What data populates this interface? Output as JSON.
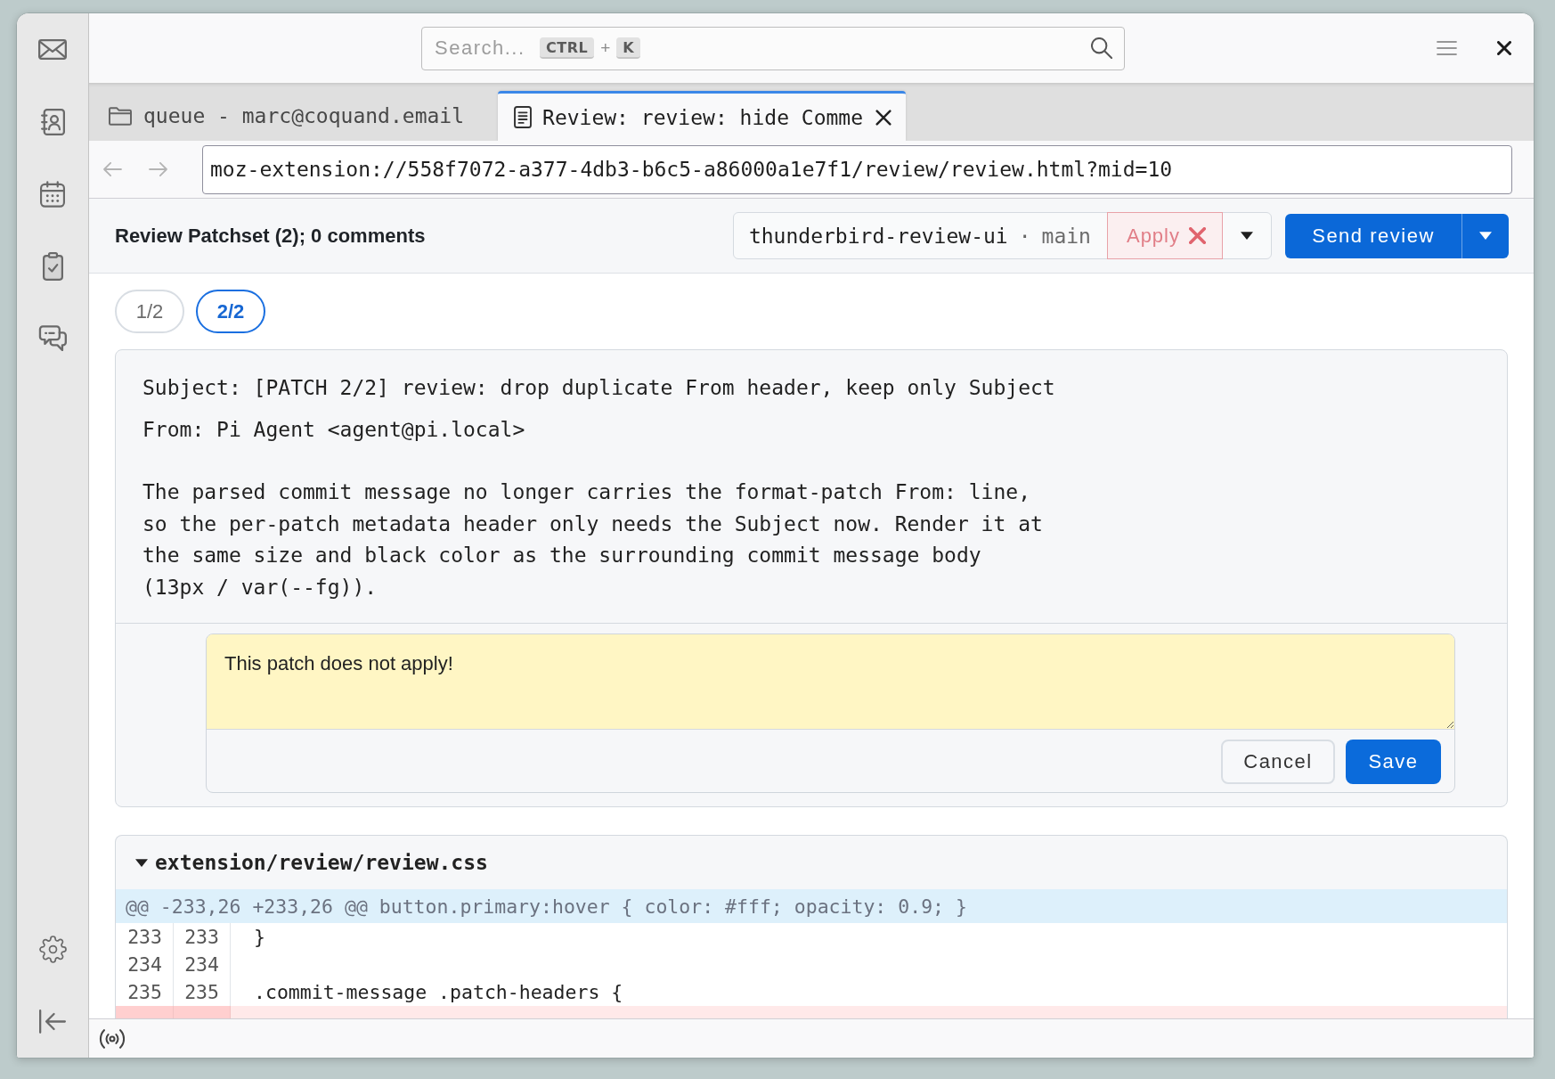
{
  "sidebar": {
    "items": [
      {
        "kind": "mail"
      },
      {
        "kind": "contacts"
      },
      {
        "kind": "calendar"
      },
      {
        "kind": "tasks"
      },
      {
        "kind": "chat"
      }
    ],
    "footer_items": [
      {
        "kind": "settings"
      },
      {
        "kind": "collapse"
      }
    ]
  },
  "search": {
    "placeholder": "Search...",
    "shortcut": {
      "keys": [
        "CTRL",
        "K"
      ],
      "separator": "+"
    }
  },
  "window_controls": [
    {
      "kind": "menu"
    },
    {
      "kind": "close"
    }
  ],
  "tabs": [
    {
      "kind": "folder",
      "title": "queue - marc@coquand.email",
      "selected": false
    },
    {
      "kind": "document",
      "title": "Review: review: hide Comme",
      "selected": true
    }
  ],
  "navigation": {
    "buttons": [
      {
        "kind": "back",
        "disabled": true
      },
      {
        "kind": "forward",
        "disabled": true
      }
    ],
    "url": "moz-extension://558f7072-a377-4db3-b6c5-a86000a1e7f1/review/review.html?mid=10"
  },
  "review_header": {
    "title": "Review Patchset (2); 0 comments",
    "repository": "thunderbird-review-ui",
    "separator": "·",
    "branch": "main",
    "apply": {
      "label": "Apply",
      "failed": true
    },
    "send_button": "Send review"
  },
  "patches": [
    {
      "label": "1/2",
      "selected": false
    },
    {
      "label": "2/2",
      "selected": true
    }
  ],
  "commit": {
    "subject": "Subject: [PATCH 2/2] review: drop duplicate From header, keep only Subject",
    "from": "From: Pi Agent <agent@pi.local>",
    "body": "The parsed commit message no longer carries the format-patch From: line,\nso the per-patch metadata header only needs the Subject now. Render it at\nthe same size and black color as the surrounding commit message body\n(13px / var(--fg))."
  },
  "comment": {
    "value": "This patch does not apply!",
    "buttons": [
      {
        "kind": "secondary",
        "label": "Cancel"
      },
      {
        "kind": "primary",
        "label": "Save"
      }
    ]
  },
  "files": [
    {
      "path": "extension/review/review.css",
      "expanded": true,
      "hunk": "@@ -233,26 +233,26 @@ button.primary:hover { color: #fff; opacity: 0.9; }",
      "lines": [
        {
          "kind": "context",
          "old": "233",
          "new": "233",
          "code": "}"
        },
        {
          "kind": "context",
          "old": "234",
          "new": "234"
        },
        {
          "kind": "context",
          "old": "235",
          "new": "235",
          "code": ".commit-message .patch-headers {"
        },
        {
          "kind": "deleted"
        }
      ]
    }
  ],
  "status_bar": {
    "items": [
      {
        "kind": "connection"
      }
    ]
  }
}
